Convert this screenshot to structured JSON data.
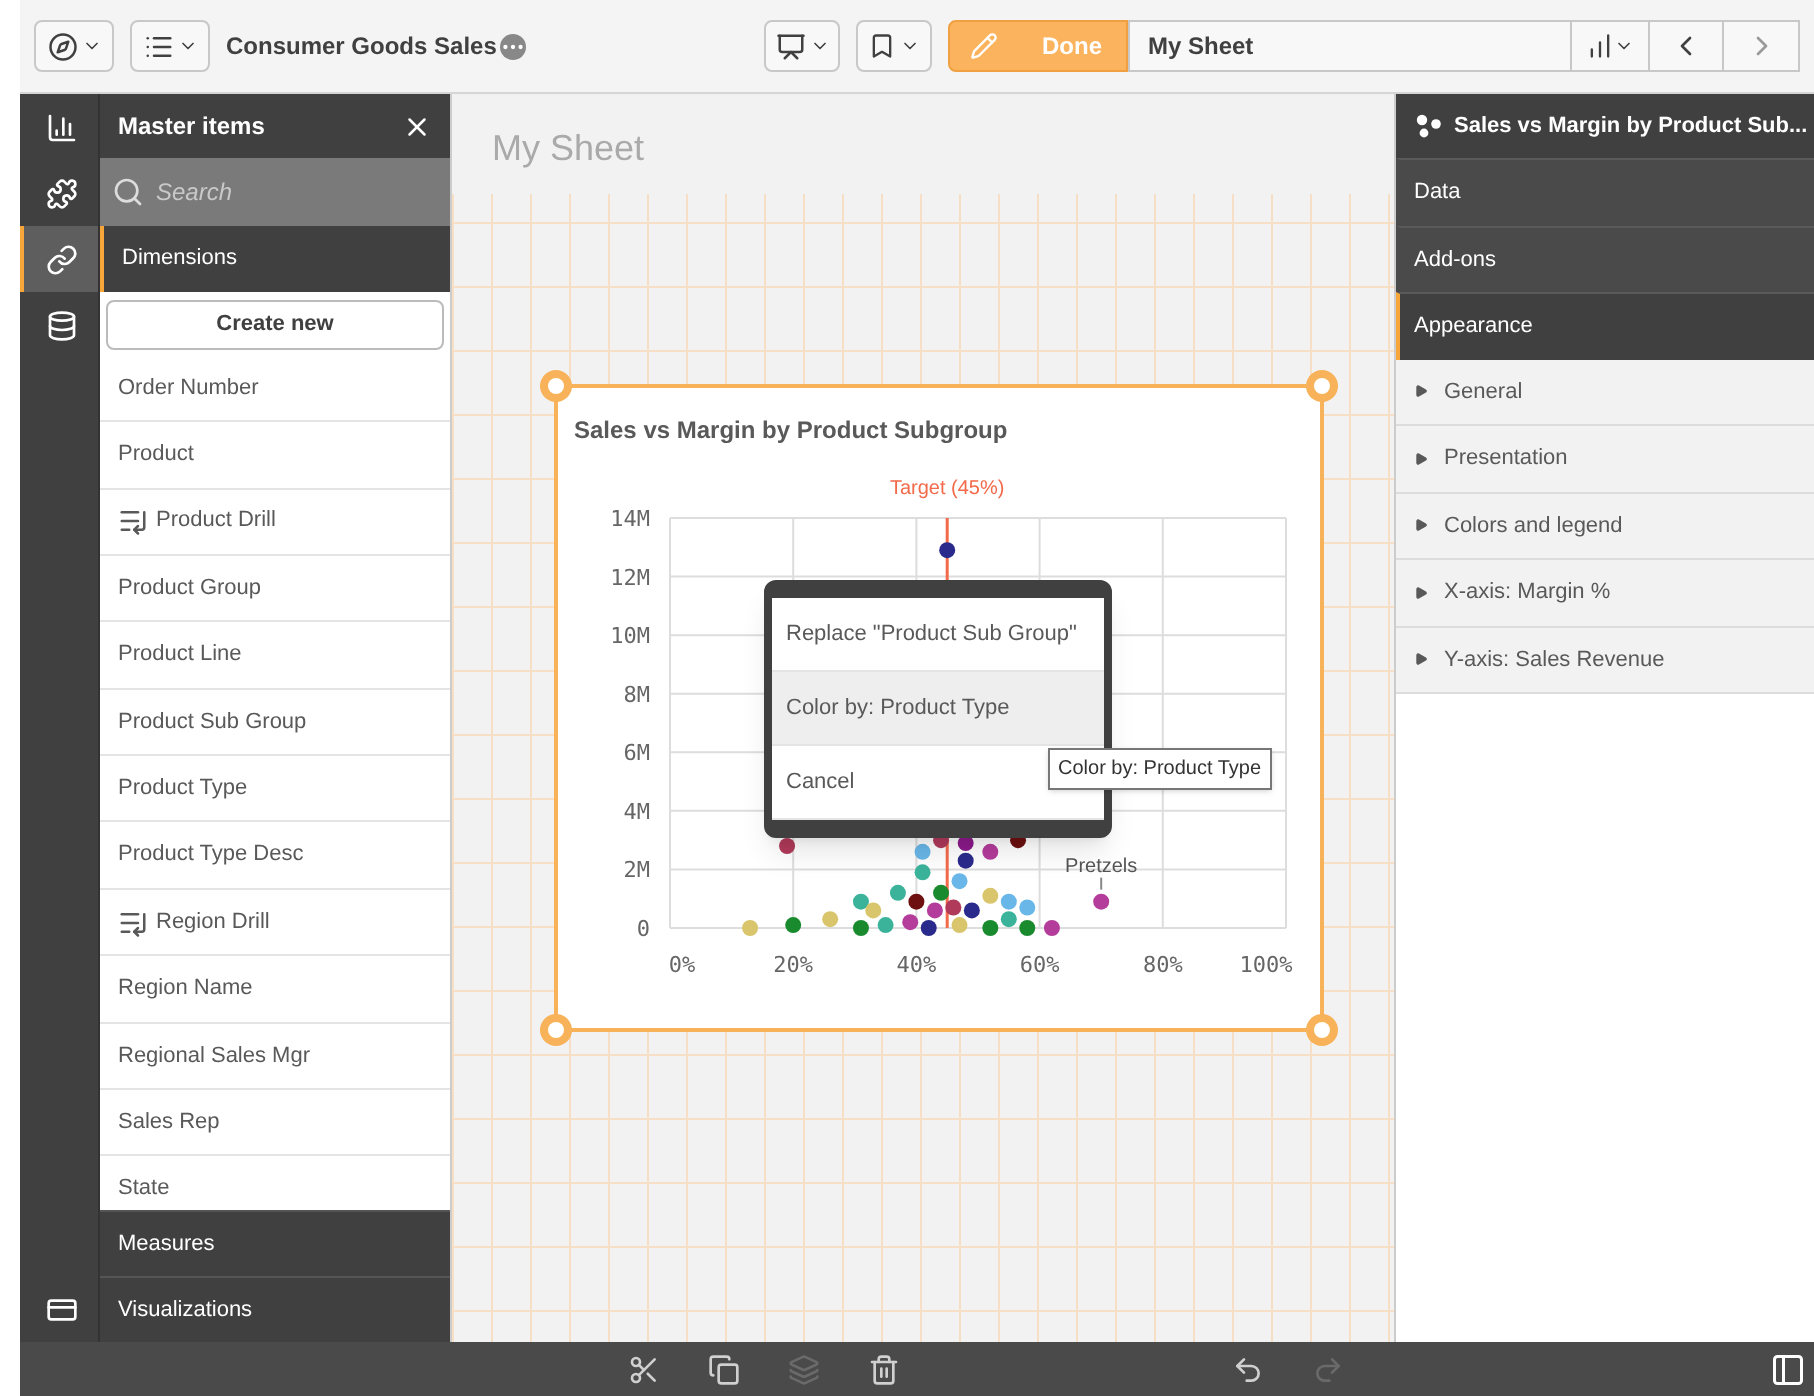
{
  "toolbar": {
    "app_title": "Consumer Goods Sales",
    "done_button": "Done",
    "sheet_title": "My Sheet"
  },
  "rail": [
    {
      "kind": "charts",
      "selected": false
    },
    {
      "kind": "extensions",
      "selected": false
    },
    {
      "kind": "master",
      "selected": true
    },
    {
      "kind": "fields",
      "selected": false
    }
  ],
  "rail_bottom": {
    "kind": "variables",
    "selected": false
  },
  "master_items": {
    "title": "Master items",
    "search": {
      "placeholder": "Search"
    },
    "dimensions": {
      "label": "Dimensions",
      "expanded": true
    },
    "create_button": "Create new",
    "items": [
      {
        "label": "Order Number",
        "drill": false
      },
      {
        "label": "Product",
        "drill": false
      },
      {
        "label": "Product Drill",
        "drill": true
      },
      {
        "label": "Product Group",
        "drill": false
      },
      {
        "label": "Product Line",
        "drill": false
      },
      {
        "label": "Product Sub Group",
        "drill": false
      },
      {
        "label": "Product Type",
        "drill": false
      },
      {
        "label": "Product Type Desc",
        "drill": false
      },
      {
        "label": "Region Drill",
        "drill": true
      },
      {
        "label": "Region Name",
        "drill": false
      },
      {
        "label": "Regional Sales Mgr",
        "drill": false
      },
      {
        "label": "Sales Rep",
        "drill": false
      },
      {
        "label": "State",
        "drill": false
      }
    ],
    "measures": {
      "label": "Measures",
      "expanded": false
    },
    "visualizations": {
      "label": "Visualizations",
      "expanded": false
    }
  },
  "canvas": {
    "sheet_title": "My Sheet",
    "chart": {
      "title": "Sales vs Margin by Product Subgroup",
      "chart_data": {
        "type": "scatter",
        "xlim": [
          0,
          1
        ],
        "ylim": [
          0,
          14
        ],
        "xticks": [
          {
            "value": 0,
            "label": "0%"
          },
          {
            "value": 0.2,
            "label": "20%"
          },
          {
            "value": 0.4,
            "label": "40%"
          },
          {
            "value": 0.6,
            "label": "60%"
          },
          {
            "value": 0.8,
            "label": "80%"
          },
          {
            "value": 1,
            "label": "100%"
          }
        ],
        "yticks": [
          {
            "value": 0,
            "label": "0"
          },
          {
            "value": 2,
            "label": "2M"
          },
          {
            "value": 4,
            "label": "4M"
          },
          {
            "value": 6,
            "label": "6M"
          },
          {
            "value": 8,
            "label": "8M"
          },
          {
            "value": 10,
            "label": "10M"
          },
          {
            "value": 12,
            "label": "12M"
          },
          {
            "value": 14,
            "label": "14M"
          }
        ],
        "series": [
          {
            "color": "#3bb39b",
            "x": [
              0.31,
              0.37,
              0.41,
              0.35,
              0.55
            ],
            "values": [
              0.9,
              1.2,
              1.9,
              0.1,
              0.3
            ]
          },
          {
            "color": "#d9c56b",
            "x": [
              0.13,
              0.26,
              0.33,
              0.52,
              0.47
            ],
            "values": [
              0,
              0.3,
              0.6,
              1.1,
              0.1
            ]
          },
          {
            "color": "#1a8a2e",
            "x": [
              0.2,
              0.31,
              0.44,
              0.52,
              0.58
            ],
            "values": [
              0.1,
              0,
              1.2,
              0,
              0
            ]
          },
          {
            "color": "#b43c9b",
            "x": [
              0.52,
              0.7,
              0.43,
              0.39,
              0.62
            ],
            "values": [
              2.6,
              0.9,
              0.6,
              0.2,
              0
            ]
          },
          {
            "color": "#2a2a8c",
            "x": [
              0.45,
              0.48,
              0.42,
              0.49
            ],
            "values": [
              12.9,
              2.3,
              0,
              0.6
            ]
          },
          {
            "color": "#b03a5a",
            "x": [
              0.19,
              0.44,
              0.46
            ],
            "values": [
              2.8,
              3.0,
              0.7
            ]
          },
          {
            "color": "#69b7e8",
            "x": [
              0.41,
              0.47,
              0.55,
              0.58
            ],
            "values": [
              2.6,
              1.6,
              0.9,
              0.7
            ]
          },
          {
            "color": "#8c1a8c",
            "x": [
              0.48
            ],
            "values": [
              2.9
            ]
          },
          {
            "color": "#6e1010",
            "x": [
              0.565,
              0.4
            ],
            "values": [
              3.0,
              0.9
            ]
          }
        ],
        "grid": true,
        "ref_lines": [
          {
            "axis": "x",
            "value": 0.45,
            "label": "Target (45%)"
          }
        ],
        "annotations": [
          {
            "x": 0.7,
            "y": 0.9,
            "text": "Pretzels"
          }
        ]
      }
    },
    "context_menu": [
      {
        "label": "Replace \"Product Sub Group\"",
        "highlighted": false
      },
      {
        "label": "Color by: Product Type",
        "highlighted": true
      },
      {
        "label": "Cancel",
        "highlighted": false
      }
    ],
    "tooltip": "Color by: Product Type"
  },
  "properties": {
    "title": "Sales vs Margin by Product Sub...",
    "tabs": [
      {
        "label": "Data",
        "selected": false
      },
      {
        "label": "Add-ons",
        "selected": false
      },
      {
        "label": "Appearance",
        "selected": true
      }
    ],
    "sections": [
      {
        "label": "General",
        "expanded": false
      },
      {
        "label": "Presentation",
        "expanded": false
      },
      {
        "label": "Colors and legend",
        "expanded": false
      },
      {
        "label": "X-axis: Margin %",
        "expanded": false
      },
      {
        "label": "Y-axis: Sales Revenue",
        "expanded": false
      }
    ]
  },
  "bottom_bar": [
    {
      "kind": "cut",
      "disabled": false
    },
    {
      "kind": "duplicate",
      "disabled": false
    },
    {
      "kind": "copy",
      "disabled": true
    },
    {
      "kind": "delete",
      "disabled": false
    },
    {
      "kind": "undo",
      "disabled": false
    },
    {
      "kind": "redo",
      "disabled": true
    }
  ]
}
